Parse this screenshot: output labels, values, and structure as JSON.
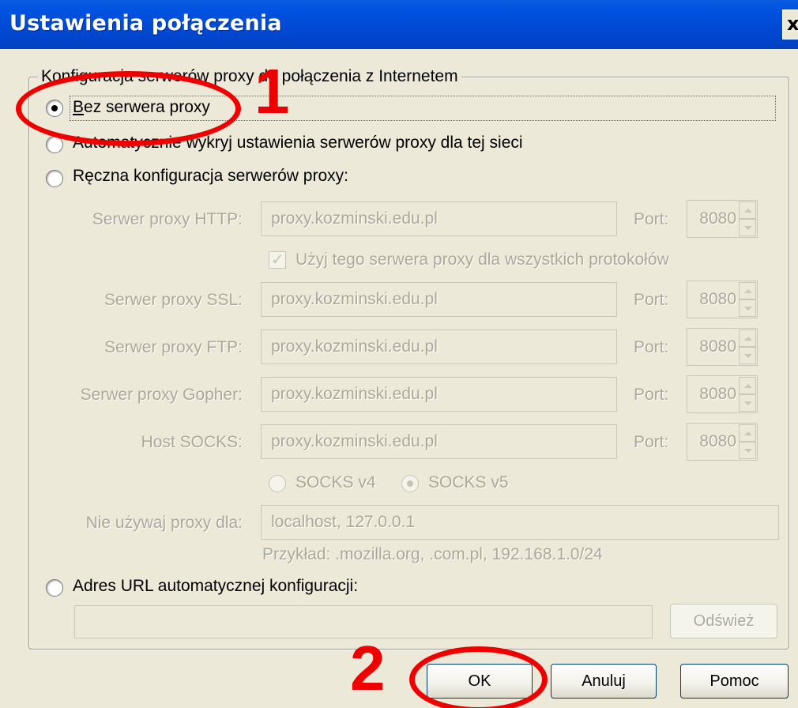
{
  "window": {
    "title": "Ustawienia połączenia",
    "close_glyph": "x"
  },
  "group": {
    "legend": "Konfiguracja serwerów proxy do połączenia z Internetem"
  },
  "options": {
    "no_proxy": "Bez serwera proxy",
    "auto_detect": "Automatycznie wykryj ustawienia serwerów proxy dla tej sieci",
    "manual": "Ręczna konfiguracja serwerów proxy:",
    "auto_url": "Adres URL automatycznej konfiguracji:"
  },
  "manual": {
    "http_label": "Serwer proxy HTTP:",
    "http_value": "proxy.kozminski.edu.pl",
    "http_port": "8080",
    "use_for_all": "Użyj tego serwera proxy dla wszystkich protokołów",
    "ssl_label": "Serwer proxy SSL:",
    "ssl_value": "proxy.kozminski.edu.pl",
    "ssl_port": "8080",
    "ftp_label": "Serwer proxy FTP:",
    "ftp_value": "proxy.kozminski.edu.pl",
    "ftp_port": "8080",
    "gopher_label": "Serwer proxy Gopher:",
    "gopher_value": "proxy.kozminski.edu.pl",
    "gopher_port": "8080",
    "socks_label": "Host SOCKS:",
    "socks_value": "proxy.kozminski.edu.pl",
    "socks_port": "8080",
    "port_label": "Port:",
    "socks_v4": "SOCKS v4",
    "socks_v5": "SOCKS v5",
    "no_proxy_for_label": "Nie używaj proxy dla:",
    "no_proxy_for_value": "localhost, 127.0.0.1",
    "example": "Przykład: .mozilla.org, .com.pl, 192.168.1.0/24"
  },
  "auto_url": {
    "value": "",
    "reload_label": "Odśwież"
  },
  "buttons": {
    "ok": "OK",
    "cancel": "Anuluj",
    "help": "Pomoc"
  },
  "annotations": {
    "step1": "1",
    "step2": "2",
    "color": "#ee0000"
  },
  "colors": {
    "titlebar": "#0053e0",
    "dialog_bg": "#ece9d8",
    "disabled_text": "#aca899"
  }
}
